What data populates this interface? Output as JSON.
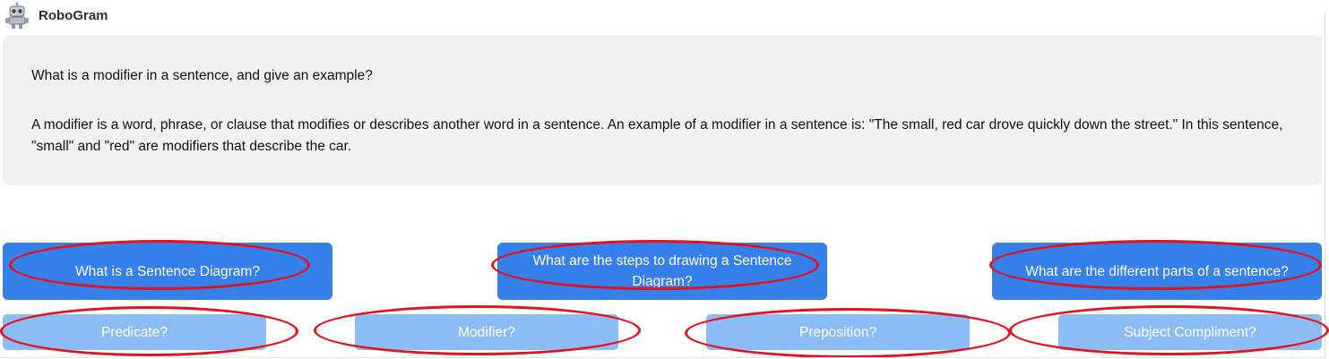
{
  "app": {
    "name": "RoboGram",
    "avatar_icon": "robot-icon"
  },
  "chat": {
    "question": "What is a modifier in a sentence, and give an example?",
    "answer": "A modifier is a word, phrase, or clause that modifies or describes another word in a sentence. An example of a modifier in a sentence is: \"The small, red car drove quickly down the street.\" In this sentence, \"small\" and \"red\" are modifiers that describe the car."
  },
  "suggestions": {
    "primary": [
      "What is a Sentence Diagram?",
      "What are the steps to drawing a Sentence Diagram?",
      "What are the different parts of a sentence?"
    ],
    "secondary": [
      "Predicate?",
      "Modifier?",
      "Preposition?",
      "Subject Compliment?"
    ]
  },
  "colors": {
    "primary_button": "#3680eb",
    "secondary_button": "#8cbcf5",
    "chat_background": "#f0f1f3",
    "annotation_ring": "#e4121b"
  }
}
